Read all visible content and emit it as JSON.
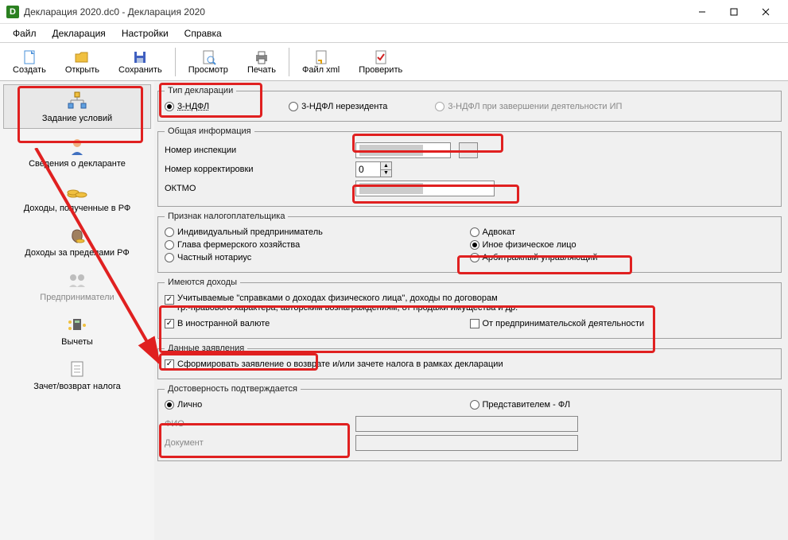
{
  "titlebar": {
    "app_icon_letter": "D",
    "title": "Декларация 2020.dc0 - Декларация 2020"
  },
  "menu": {
    "file": "Файл",
    "declaration": "Декларация",
    "settings": "Настройки",
    "help": "Справка"
  },
  "toolbar": {
    "create": "Создать",
    "open": "Открыть",
    "save": "Сохранить",
    "preview": "Просмотр",
    "print": "Печать",
    "xml": "Файл xml",
    "check": "Проверить"
  },
  "sidebar": {
    "conditions": "Задание условий",
    "declarant": "Сведения о декларанте",
    "income_rf": "Доходы, полученные в РФ",
    "income_foreign": "Доходы за пределами РФ",
    "entrepreneurs": "Предприниматели",
    "deductions": "Вычеты",
    "offset_refund": "Зачет/возврат налога"
  },
  "decl_type": {
    "legend": "Тип декларации",
    "opt1": "3-НДФЛ",
    "opt2": "3-НДФЛ нерезидента",
    "opt3": "3-НДФЛ при завершении деятельности ИП"
  },
  "general": {
    "legend": "Общая информация",
    "inspection": "Номер инспекции",
    "correction": "Номер корректировки",
    "correction_val": "0",
    "oktmo": "ОКТМО"
  },
  "taxpayer": {
    "legend": "Признак налогоплательщика",
    "ip": "Индивидуальный предприниматель",
    "farm": "Глава фермерского хозяйства",
    "notary": "Частный нотариус",
    "lawyer": "Адвокат",
    "other": "Иное физическое лицо",
    "arbitr": "Арбитражный управляющий"
  },
  "income": {
    "legend": "Имеются доходы",
    "spravka_line1": "Учитываемые \"справками о доходах физического лица\", доходы по договорам",
    "spravka_line2": "гр.-правового характера, авторским вознаграждениям, от продажи имущества и др.",
    "foreign": "В иностранной валюте",
    "entrepreneurial": "От предпринимательской деятельности"
  },
  "statement": {
    "legend": "Данные заявления",
    "form_statement": "Сформировать заявление о  возврате и/или зачете налога в рамках декларации"
  },
  "authenticity": {
    "legend": "Достоверность подтверждается",
    "personal": "Лично",
    "representative": "Представителем - ФЛ",
    "fio": "ФИО",
    "document": "Документ"
  }
}
